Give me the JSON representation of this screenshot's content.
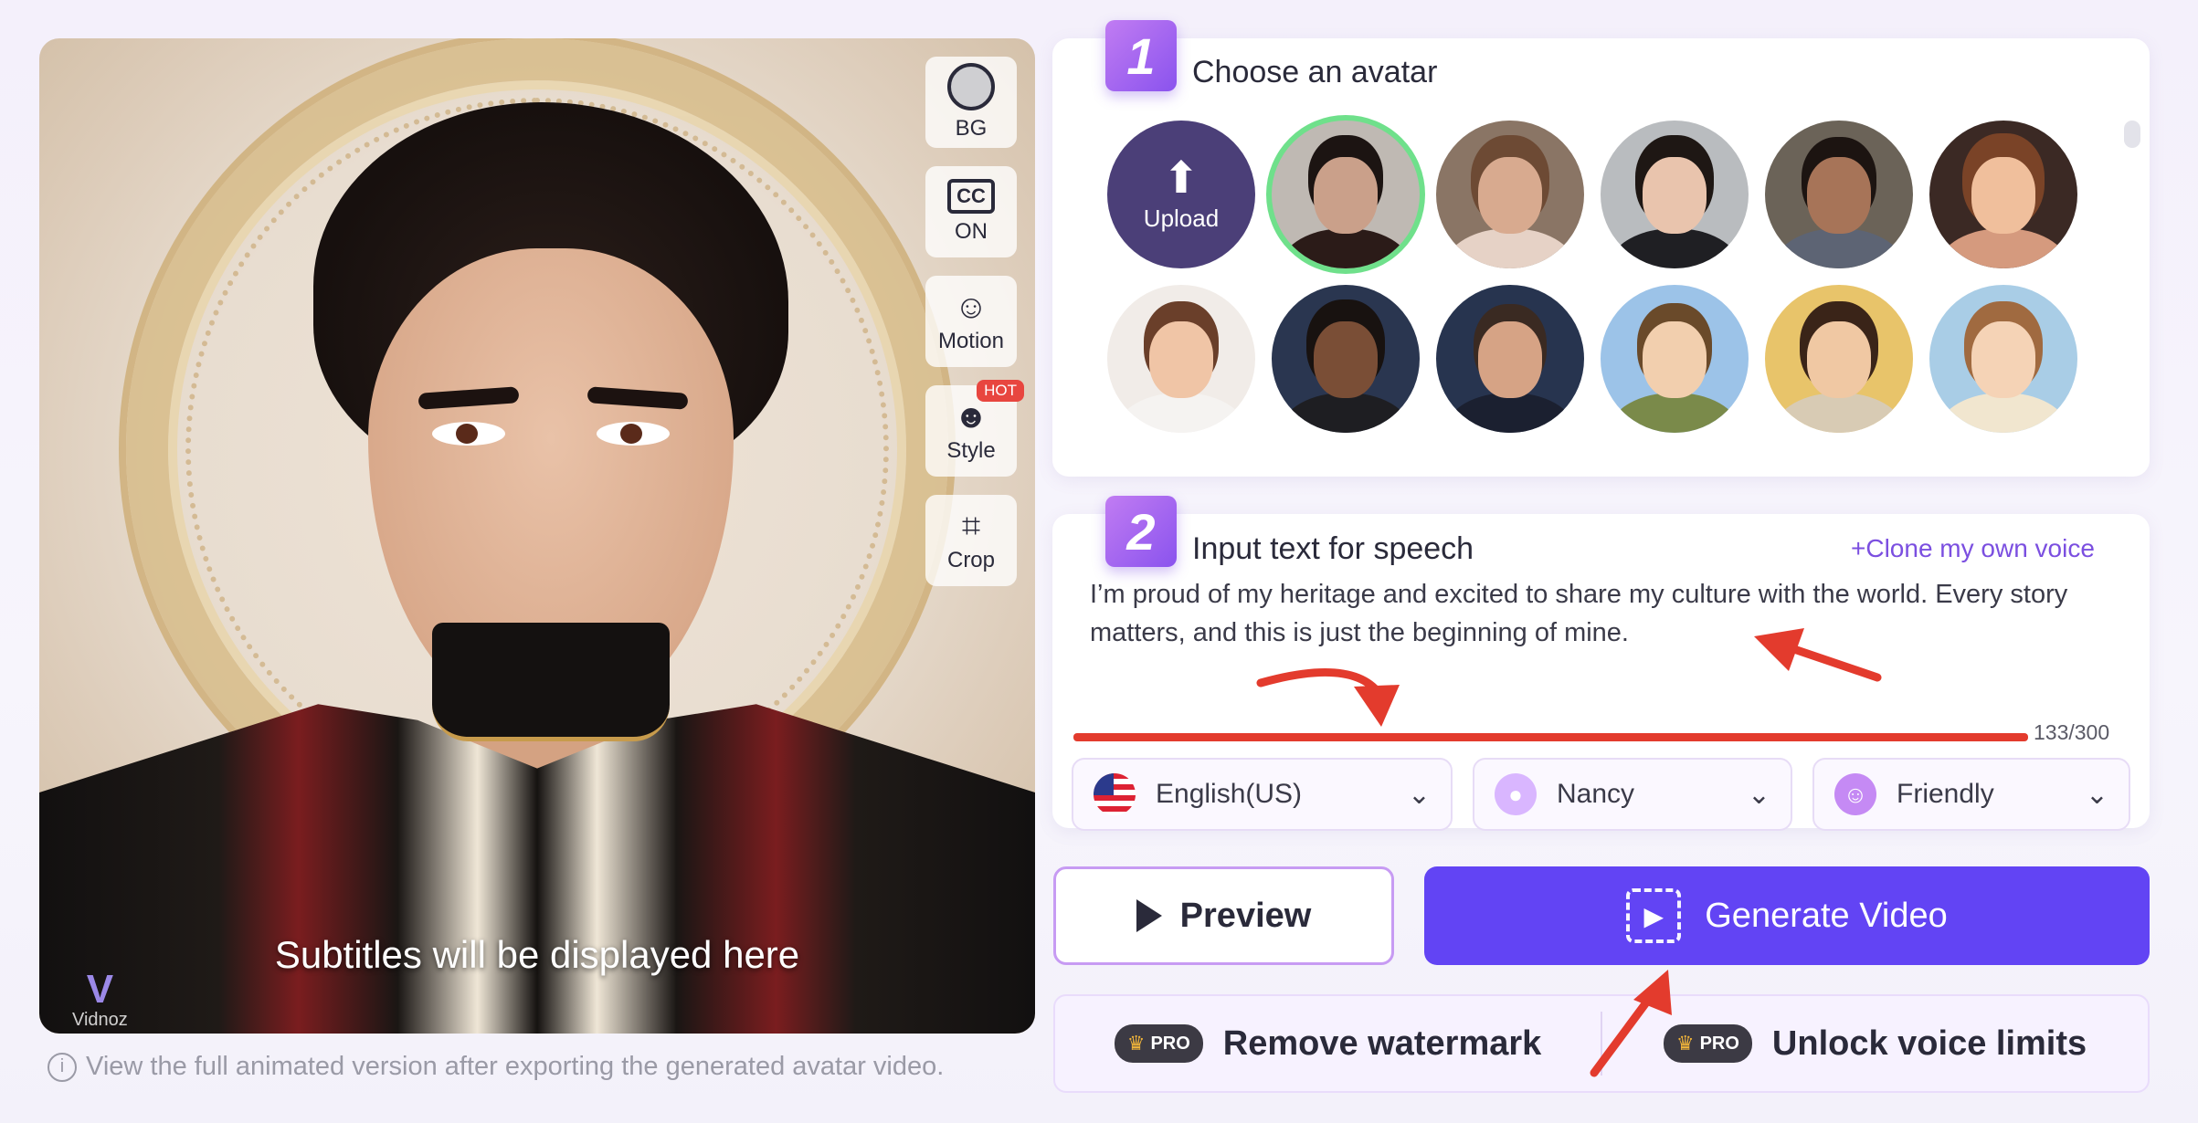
{
  "preview": {
    "subtitle": "Subtitles will be displayed here",
    "watermark": "Vidnoz",
    "note": "View the full animated version after exporting the generated avatar video."
  },
  "tools": [
    {
      "label": "BG",
      "icon": "bg-circle-icon"
    },
    {
      "label": "ON",
      "icon": "cc-icon"
    },
    {
      "label": "Motion",
      "icon": "motion-icon"
    },
    {
      "label": "Style",
      "icon": "style-icon",
      "badge": "HOT"
    },
    {
      "label": "Crop",
      "icon": "crop-icon"
    }
  ],
  "step1": {
    "number": "1",
    "title": "Choose an avatar",
    "upload_label": "Upload"
  },
  "step2": {
    "number": "2",
    "title": "Input text for speech",
    "clone_label": "Clone my own voice",
    "text": "I’m proud of my heritage and excited to share my culture with the world. Every story matters, and this is just the beginning of mine.",
    "counter": "133/300"
  },
  "selects": {
    "language": "English(US)",
    "voice": "Nancy",
    "tone": "Friendly"
  },
  "buttons": {
    "preview": "Preview",
    "generate": "Generate Video"
  },
  "upsell": {
    "pro_badge": "PRO",
    "remove_watermark": "Remove watermark",
    "unlock_voice": "Unlock voice limits"
  },
  "colors": {
    "accent": "#6244f4",
    "annotation": "#e33b2d",
    "selected_ring": "#6fe08b"
  }
}
